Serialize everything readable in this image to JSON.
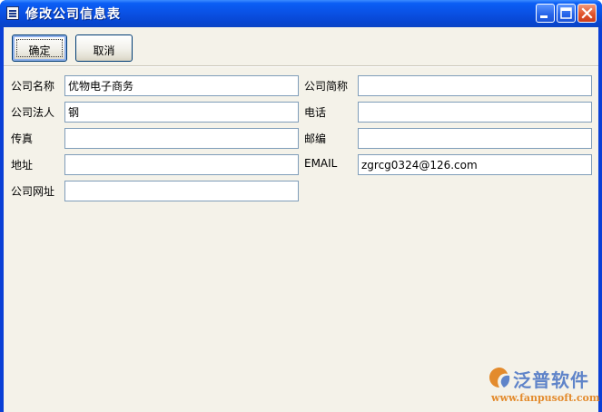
{
  "window": {
    "title": "修改公司信息表"
  },
  "toolbar": {
    "confirm_label": "确定",
    "cancel_label": "取消"
  },
  "form": {
    "company_name_label": "公司名称",
    "company_name_value": "优物电子商务",
    "short_name_label": "公司简称",
    "short_name_value": "",
    "legal_person_label": "公司法人",
    "legal_person_value": "钢",
    "phone_label": "电话",
    "phone_value": "",
    "fax_label": "传真",
    "fax_value": "",
    "postcode_label": "邮编",
    "postcode_value": "",
    "address_label": "地址",
    "address_value": "",
    "email_label": "EMAIL",
    "email_value": "zgrcg0324@126.com",
    "website_label": "公司网址",
    "website_value": ""
  },
  "watermark": {
    "brand": "泛普软件",
    "url": "www.fanpusoft.com"
  },
  "colors": {
    "title_bar": "#0a52e6",
    "client_bg": "#f4f2e9",
    "field_border": "#7f9db9",
    "brand_blue": "#5f84c9",
    "brand_orange": "#e38b2d"
  },
  "icons": [
    "app-window-icon",
    "minimize-icon",
    "maximize-icon",
    "close-icon",
    "fanpu-logo-icon"
  ]
}
